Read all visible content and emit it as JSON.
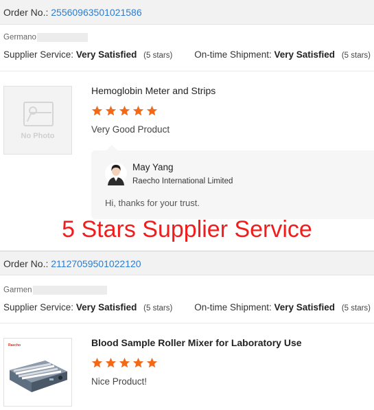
{
  "colors": {
    "accent_link": "#2c7cd1",
    "star": "#f06a1a",
    "overlay_red": "#f11c1c"
  },
  "overlay": {
    "text": "5 Stars Supplier Service"
  },
  "orders": [
    {
      "order_label": "Order No.:",
      "order_number": "25560963501021586",
      "buyer": "Germano",
      "supplier_service_label": "Supplier Service:",
      "supplier_service_value": "Very Satisfied",
      "supplier_service_stars": "(5 stars)",
      "shipment_label": "On-time Shipment:",
      "shipment_value": "Very Satisfied",
      "shipment_stars": "(5 stars)",
      "product_title": "Hemoglobin Meter and Strips",
      "product_image": "No Photo",
      "rating": 5,
      "review": "Very Good Product",
      "reply": {
        "name": "May Yang",
        "company": "Raecho International Limited",
        "message": "Hi, thanks for your trust."
      }
    },
    {
      "order_label": "Order No.:",
      "order_number": "21127059501022120",
      "buyer": "Garmen",
      "supplier_service_label": "Supplier Service:",
      "supplier_service_value": "Very Satisfied",
      "supplier_service_stars": "(5 stars)",
      "shipment_label": "On-time Shipment:",
      "shipment_value": "Very Satisfied",
      "shipment_stars": "(5 stars)",
      "product_title": "Blood Sample Roller Mixer for Laboratory Use",
      "product_image_brand": "Raecho",
      "rating": 5,
      "review": "Nice Product!"
    }
  ]
}
